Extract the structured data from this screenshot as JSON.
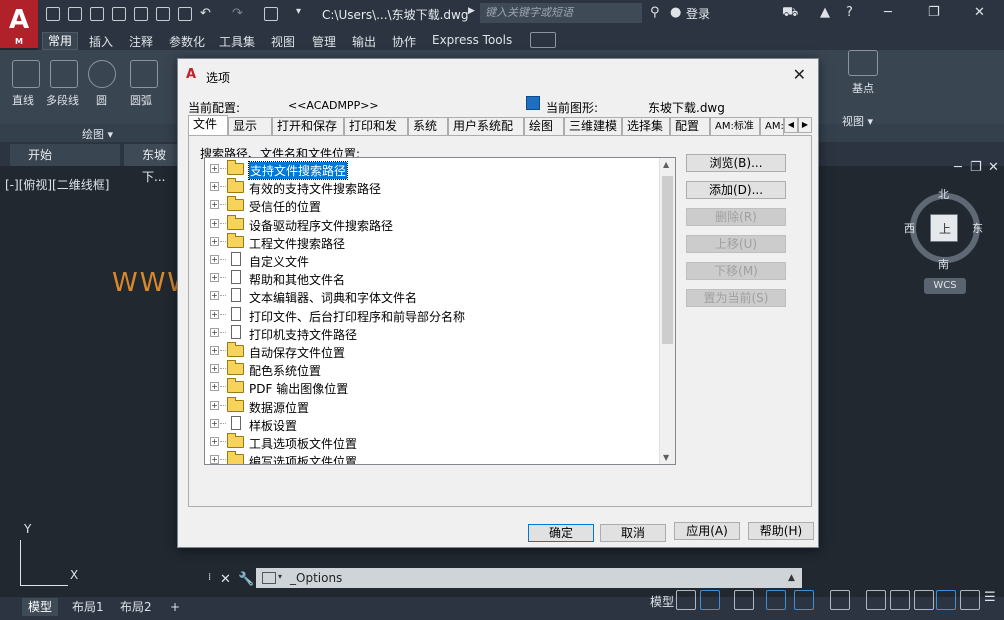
{
  "app": {
    "logo_letter": "A",
    "logo_sub": "M",
    "doc_title": "C:\\Users\\...\\东坡下载.dwg",
    "search_placeholder": "键入关键字或短语",
    "login": "登录"
  },
  "ribbon": {
    "tabs": [
      "常用",
      "插入",
      "注释",
      "参数化",
      "工具集",
      "视图",
      "管理",
      "输出",
      "协作",
      "Express Tools"
    ],
    "draw_tools": [
      "直线",
      "多段线",
      "圆",
      "圆弧"
    ],
    "draw_panel": "绘图",
    "right_group": "基点",
    "view_panel": "视图"
  },
  "doc_tabs": [
    "开始",
    "东坡下..."
  ],
  "viewport_label": "[-][俯视][二维线框]",
  "canvas_text": "WWW",
  "compass": {
    "n": "北",
    "s": "南",
    "e": "东",
    "w": "西"
  },
  "viewcube_face": "上",
  "wcs": "WCS",
  "ucs": {
    "x": "X",
    "y": "Y"
  },
  "command": {
    "value": "_Options"
  },
  "status": {
    "layout_tabs": [
      "模型",
      "布局1",
      "布局2",
      "+"
    ],
    "model_label": "模型"
  },
  "dialog": {
    "title": "选项",
    "current_profile_label": "当前配置:",
    "current_profile_value": "<<ACADMPP>>",
    "current_drawing_label": "当前图形:",
    "current_drawing_value": "东坡下载.dwg",
    "tabs": [
      "文件",
      "显示",
      "打开和保存",
      "打印和发布",
      "系统",
      "用户系统配置",
      "绘图",
      "三维建模",
      "选择集",
      "配置",
      "AM:标准",
      "AM:"
    ],
    "section_label": "搜索路径、文件名和文件位置:",
    "tree": [
      {
        "label": "支持文件搜索路径",
        "icon": "folder",
        "selected": true
      },
      {
        "label": "有效的支持文件搜索路径",
        "icon": "folder"
      },
      {
        "label": "受信任的位置",
        "icon": "folder"
      },
      {
        "label": "设备驱动程序文件搜索路径",
        "icon": "folder"
      },
      {
        "label": "工程文件搜索路径",
        "icon": "folder"
      },
      {
        "label": "自定义文件",
        "icon": "document"
      },
      {
        "label": "帮助和其他文件名",
        "icon": "document"
      },
      {
        "label": "文本编辑器、词典和字体文件名",
        "icon": "document"
      },
      {
        "label": "打印文件、后台打印程序和前导部分名称",
        "icon": "document"
      },
      {
        "label": "打印机支持文件路径",
        "icon": "document"
      },
      {
        "label": "自动保存文件位置",
        "icon": "folder"
      },
      {
        "label": "配色系统位置",
        "icon": "folder"
      },
      {
        "label": "PDF 输出图像位置",
        "icon": "folder"
      },
      {
        "label": "数据源位置",
        "icon": "folder"
      },
      {
        "label": "样板设置",
        "icon": "document"
      },
      {
        "label": "工具选项板文件位置",
        "icon": "folder"
      },
      {
        "label": "编写选项板文件位置",
        "icon": "folder"
      }
    ],
    "side_buttons": [
      {
        "label": "浏览(B)...",
        "enabled": true
      },
      {
        "label": "添加(D)...",
        "enabled": true
      },
      {
        "label": "删除(R)",
        "enabled": false
      },
      {
        "label": "上移(U)",
        "enabled": false
      },
      {
        "label": "下移(M)",
        "enabled": false
      },
      {
        "label": "置为当前(S)",
        "enabled": false
      }
    ],
    "ok": "确定",
    "cancel": "取消",
    "apply": "应用(A)",
    "help": "帮助(H)"
  }
}
